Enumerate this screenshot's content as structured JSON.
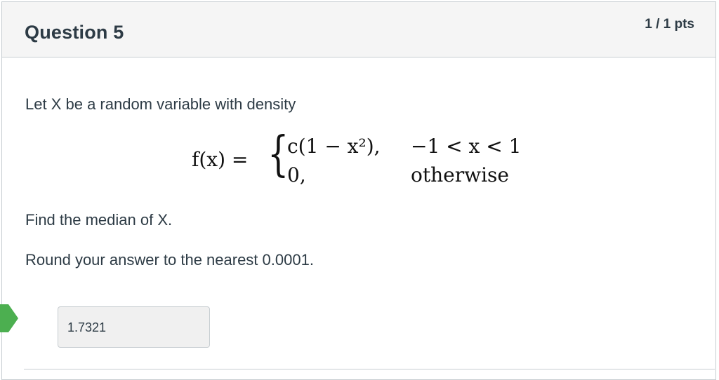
{
  "question": {
    "title": "Question 5",
    "points": "1 / 1 pts",
    "intro": "Let X be a random variable with density",
    "find": "Find the median of X.",
    "round": "Round your answer to the nearest 0.0001."
  },
  "equation": {
    "lhs": "f(x) =",
    "brace": "{",
    "case1_expr": "c(1 − x²),",
    "case1_cond": "−1 < x < 1",
    "case2_expr": "0,",
    "case2_cond": "otherwise"
  },
  "answer": {
    "value": "1.7321",
    "status": "correct",
    "flag_color": "#4caf50"
  },
  "colors": {
    "text": "#2d3b45",
    "header_bg": "#f5f5f5",
    "border": "#c7cdd1",
    "answer_bg": "#f0f0f0"
  }
}
